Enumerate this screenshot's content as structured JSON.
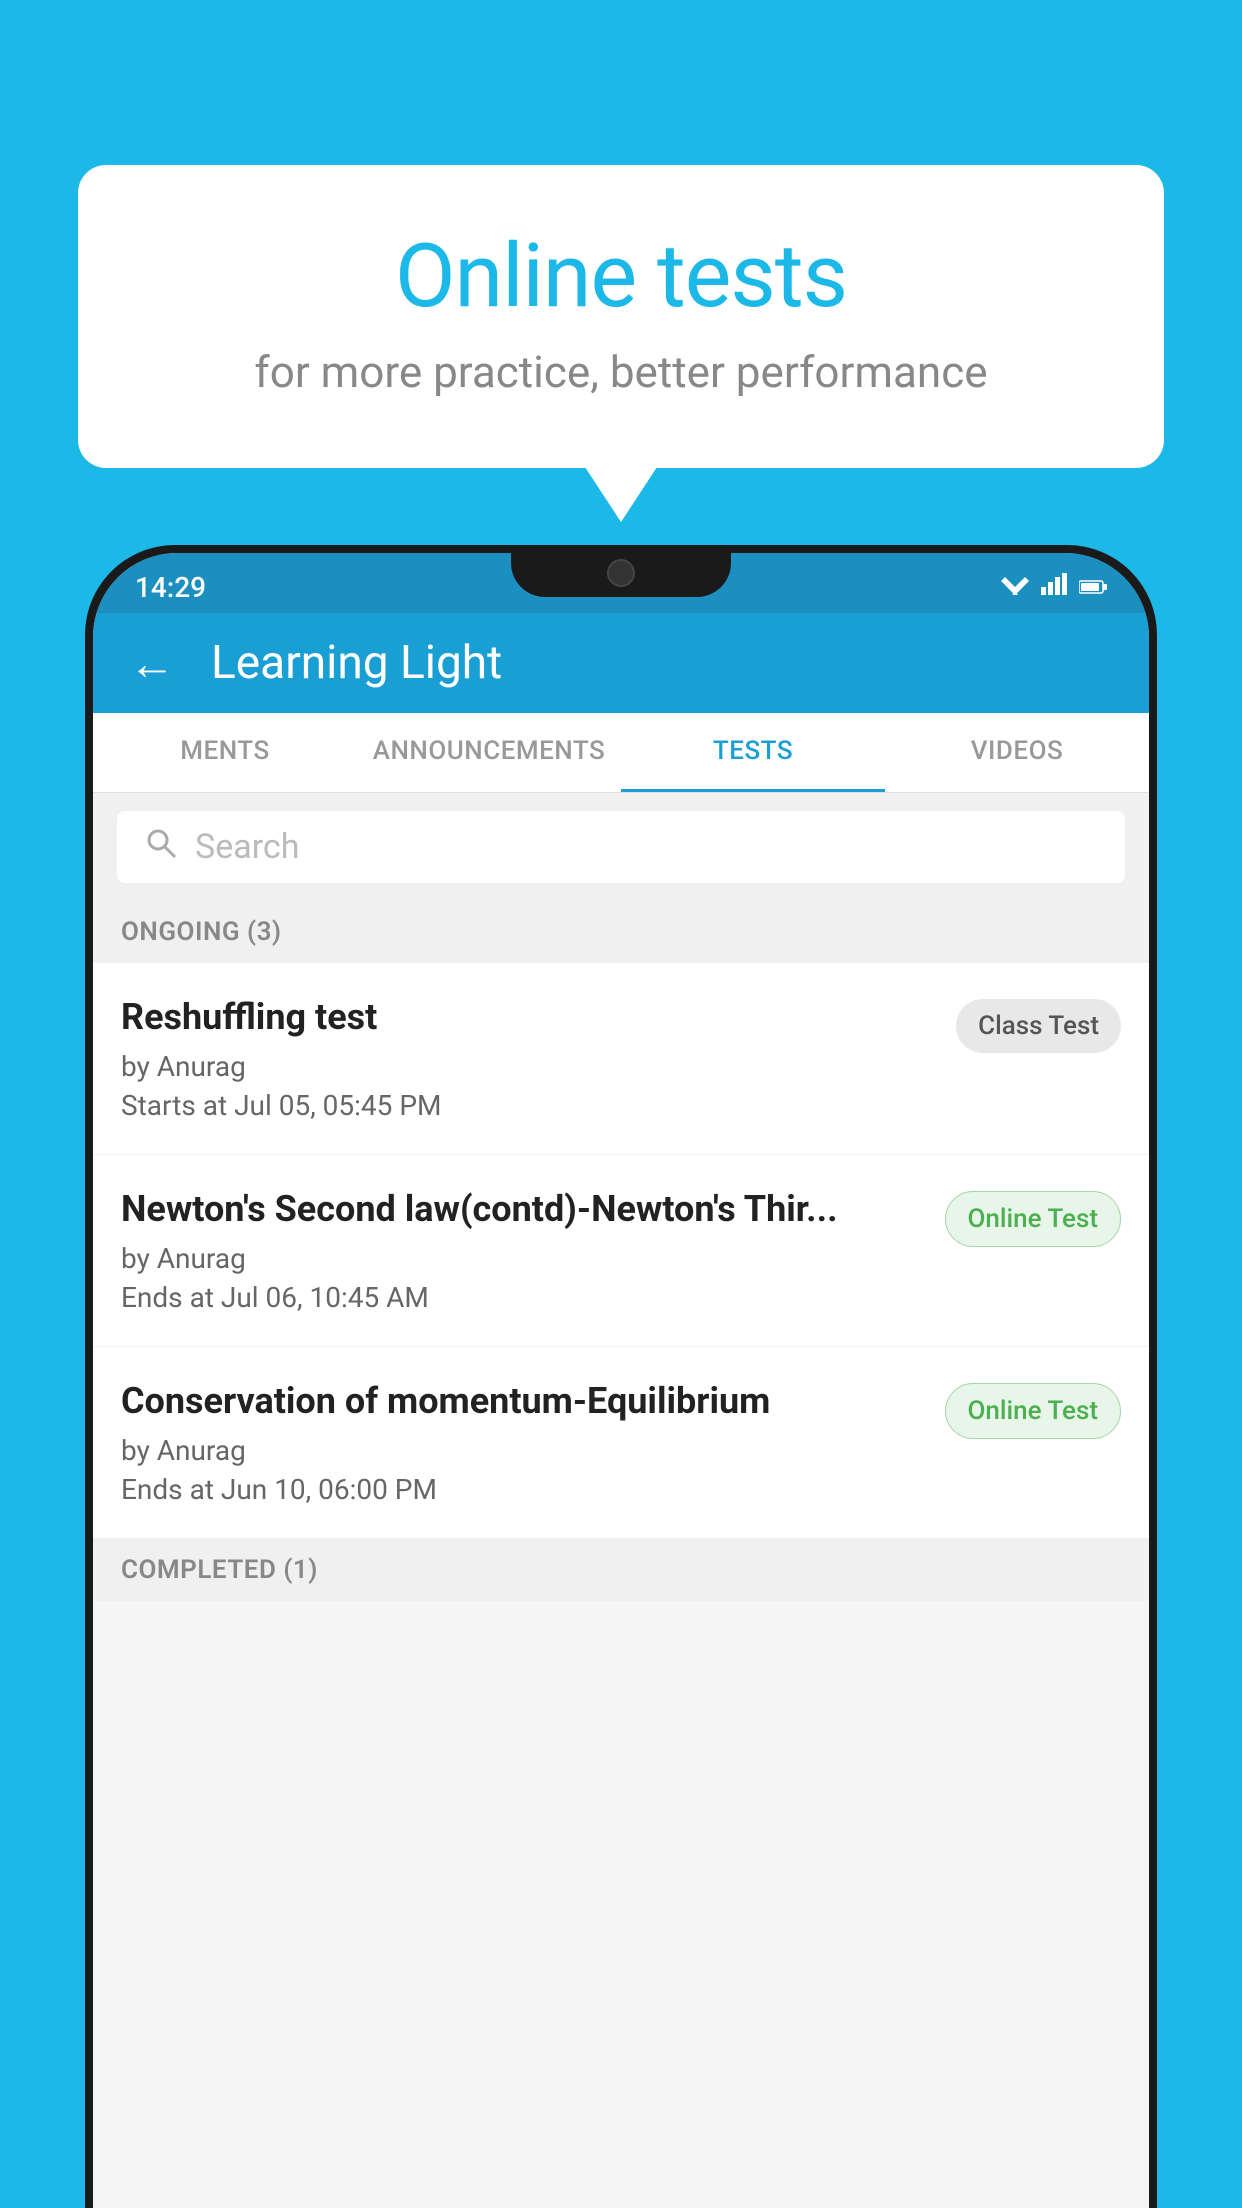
{
  "background_color": "#1bb8e8",
  "bubble": {
    "title": "Online tests",
    "subtitle": "for more practice, better performance"
  },
  "phone": {
    "status_bar": {
      "time": "14:29",
      "icons": [
        "wifi",
        "signal",
        "battery"
      ]
    },
    "app_bar": {
      "title": "Learning Light",
      "back_label": "←"
    },
    "tabs": [
      {
        "label": "MENTS",
        "active": false
      },
      {
        "label": "ANNOUNCEMENTS",
        "active": false
      },
      {
        "label": "TESTS",
        "active": true
      },
      {
        "label": "VIDEOS",
        "active": false
      }
    ],
    "search": {
      "placeholder": "Search"
    },
    "section_ongoing": {
      "label": "ONGOING (3)"
    },
    "tests": [
      {
        "name": "Reshuffling test",
        "by": "by Anurag",
        "time": "Starts at  Jul 05, 05:45 PM",
        "badge": "Class Test",
        "badge_type": "class"
      },
      {
        "name": "Newton's Second law(contd)-Newton's Thir...",
        "by": "by Anurag",
        "time": "Ends at  Jul 06, 10:45 AM",
        "badge": "Online Test",
        "badge_type": "online"
      },
      {
        "name": "Conservation of momentum-Equilibrium",
        "by": "by Anurag",
        "time": "Ends at  Jun 10, 06:00 PM",
        "badge": "Online Test",
        "badge_type": "online"
      }
    ],
    "section_completed": {
      "label": "COMPLETED (1)"
    }
  }
}
